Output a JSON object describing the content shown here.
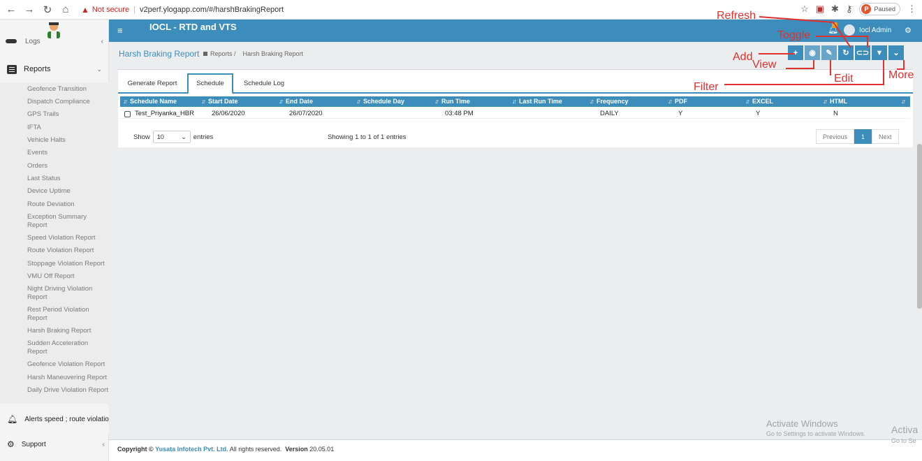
{
  "browser": {
    "not_secure": "Not secure",
    "url": "v2perf.ylogapp.com/#/harshBrakingReport",
    "paused_initial": "P",
    "paused_label": "Paused"
  },
  "sidebar": {
    "logs_label": "Logs",
    "reports_label": "Reports",
    "items": [
      "Geofence Transition",
      "Dispatch Compliance",
      "GPS Trails",
      "IFTA",
      "Vehicle Halts",
      "Events",
      "Orders",
      "Last Status",
      "Device Uptime",
      "Route Deviation",
      "Exception Summary Report",
      "Speed Violation Report",
      "Route Violation Report",
      "Stoppage Violation Report",
      "VMU Off Report",
      "Night Driving Violation Report",
      "Rest Period Violation Report",
      "Harsh Braking Report",
      "Sudden Acceleration Report",
      "Geofence Violation Report",
      "Harsh Maneuvering Report",
      "Daily Drive Violation Report"
    ],
    "alerts_label": "Alerts speed ; route violation;",
    "support_label": "Support"
  },
  "header": {
    "title": "IOCL - RTD and VTS",
    "notification_count": "6",
    "user": "Iocl Admin"
  },
  "page": {
    "title": "Harsh Braking Report",
    "crumb1": "Reports /",
    "crumb2": "Harsh Braking Report"
  },
  "tabs": [
    "Generate Report",
    "Schedule",
    "Schedule Log"
  ],
  "table": {
    "columns": [
      "Schedule Name",
      "Start Date",
      "End Date",
      "Schedule Day",
      "Run Time",
      "Last Run Time",
      "Frequency",
      "PDF",
      "EXCEL",
      "HTML"
    ],
    "rows": [
      [
        "Test_Priyanka_HBR",
        "26/06/2020",
        "26/07/2020",
        "",
        "03:48 PM",
        "",
        "DAILY",
        "Y",
        "Y",
        "N"
      ]
    ]
  },
  "listing": {
    "show": "Show",
    "entries_value": "10",
    "entries": "entries",
    "info": "Showing 1 to 1 of 1 entries",
    "previous": "Previous",
    "page": "1",
    "next": "Next"
  },
  "annotations": {
    "refresh": "Refresh",
    "toggle": "Toggle",
    "add": "Add",
    "view": "View",
    "edit": "Edit",
    "filter": "Filter",
    "more": "More",
    "color": "#e0312f"
  },
  "footer": {
    "copyright": "Copyright ©",
    "company": "Yusata Infotech Pvt. Ltd.",
    "rights": "All rights reserved.",
    "version_label": "Version",
    "version": "20.05.01"
  },
  "watermark": {
    "title": "Activate Windows",
    "sub": "Go to Settings to activate Windows.",
    "title2": "Activa",
    "sub2": "Go to Se"
  },
  "colors": {
    "primary": "#3c8dbc",
    "sidebar": "#f4f4f4"
  }
}
